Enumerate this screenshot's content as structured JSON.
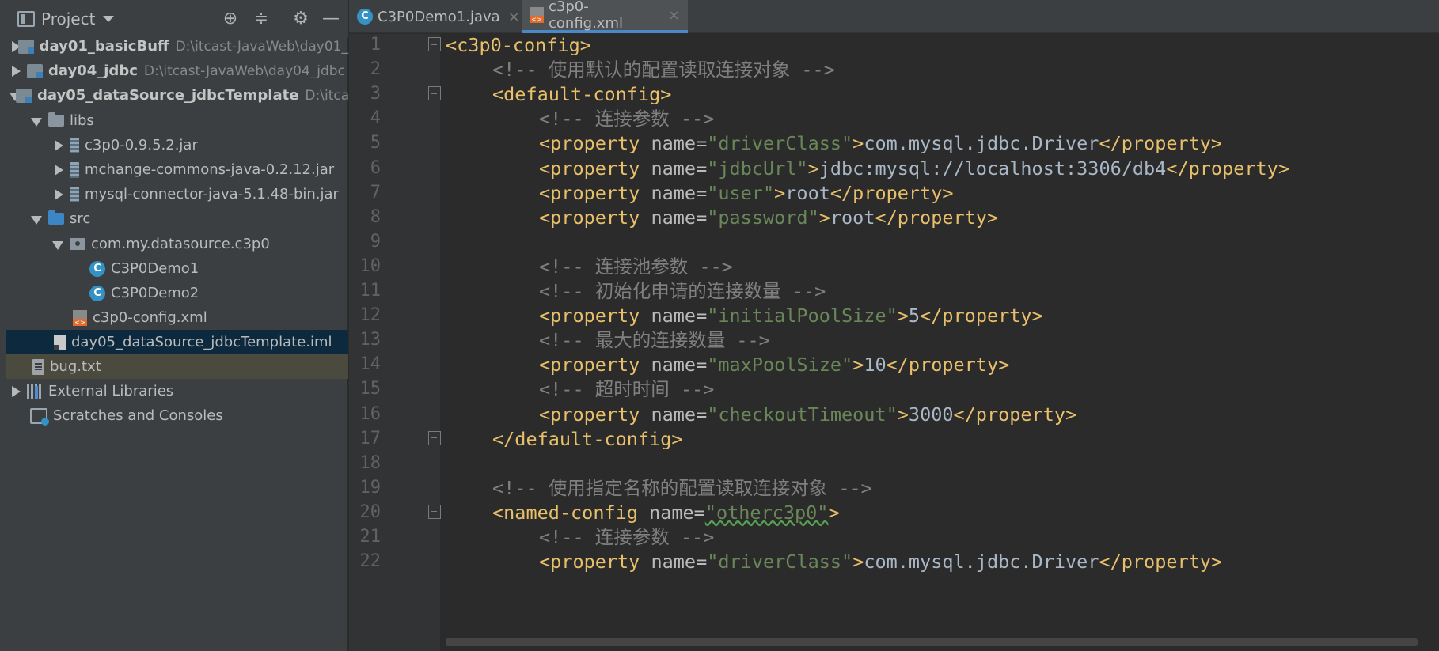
{
  "project_panel": {
    "title": "Project",
    "header_icons": [
      "locate-icon",
      "collapse-all-icon",
      "gear-icon",
      "minimize-icon"
    ],
    "tree": [
      {
        "label": "day01_basicBuff",
        "path": "D:\\itcast-JavaWeb\\day01_",
        "icon": "module-icon",
        "expanded": false
      },
      {
        "label": "day04_jdbc",
        "path": "D:\\itcast-JavaWeb\\day04_jdbc",
        "icon": "module-icon",
        "expanded": false
      },
      {
        "label": "day05_dataSource_jdbcTemplate",
        "path": "D:\\itcast",
        "icon": "module-icon",
        "expanded": true
      },
      {
        "label": "libs",
        "icon": "folder-icon",
        "expanded": true
      },
      {
        "label": "c3p0-0.9.5.2.jar",
        "icon": "jar-icon",
        "expanded": false
      },
      {
        "label": "mchange-commons-java-0.2.12.jar",
        "icon": "jar-icon",
        "expanded": false
      },
      {
        "label": "mysql-connector-java-5.1.48-bin.jar",
        "icon": "jar-icon",
        "expanded": false
      },
      {
        "label": "src",
        "icon": "source-folder-icon",
        "expanded": true
      },
      {
        "label": "com.my.datasource.c3p0",
        "icon": "package-icon",
        "expanded": true
      },
      {
        "label": "C3P0Demo1",
        "icon": "java-class-icon"
      },
      {
        "label": "C3P0Demo2",
        "icon": "java-class-icon"
      },
      {
        "label": "c3p0-config.xml",
        "icon": "xml-file-icon"
      },
      {
        "label": "day05_dataSource_jdbcTemplate.iml",
        "icon": "iml-file-icon",
        "selected": true
      },
      {
        "label": "bug.txt",
        "icon": "text-file-icon"
      },
      {
        "label": "External Libraries",
        "icon": "libraries-icon",
        "expanded": false
      },
      {
        "label": "Scratches and Consoles",
        "icon": "scratches-icon"
      }
    ]
  },
  "tabs": [
    {
      "label": "C3P0Demo1.java",
      "icon": "java-class-icon",
      "active": false
    },
    {
      "label": "c3p0-config.xml",
      "icon": "xml-file-icon",
      "active": true
    }
  ],
  "editor": {
    "line_numbers": [
      "1",
      "2",
      "3",
      "4",
      "5",
      "6",
      "7",
      "8",
      "9",
      "10",
      "11",
      "12",
      "13",
      "14",
      "15",
      "16",
      "17",
      "18",
      "19",
      "20",
      "21",
      "22"
    ],
    "lines": [
      {
        "seg": [
          [
            "t",
            "<c3p0-config>"
          ]
        ]
      },
      {
        "seg": [
          [
            "c",
            "<!-- 使用默认的配置读取连接对象 -->"
          ]
        ]
      },
      {
        "seg": [
          [
            "t",
            "<default-config>"
          ]
        ]
      },
      {
        "seg": [
          [
            "c",
            "<!-- 连接参数 -->"
          ]
        ]
      },
      {
        "seg": [
          [
            "t",
            "<property "
          ],
          [
            "a",
            "name="
          ],
          [
            "v",
            "\"driverClass\""
          ],
          [
            "t",
            ">"
          ],
          [
            "x",
            "com.mysql.jdbc.Driver"
          ],
          [
            "t",
            "</property>"
          ]
        ]
      },
      {
        "seg": [
          [
            "t",
            "<property "
          ],
          [
            "a",
            "name="
          ],
          [
            "v",
            "\"jdbcUrl\""
          ],
          [
            "t",
            ">"
          ],
          [
            "x",
            "jdbc:mysql://localhost:3306/db4"
          ],
          [
            "t",
            "</property>"
          ]
        ]
      },
      {
        "seg": [
          [
            "t",
            "<property "
          ],
          [
            "a",
            "name="
          ],
          [
            "v",
            "\"user\""
          ],
          [
            "t",
            ">"
          ],
          [
            "x",
            "root"
          ],
          [
            "t",
            "</property>"
          ]
        ]
      },
      {
        "seg": [
          [
            "t",
            "<property "
          ],
          [
            "a",
            "name="
          ],
          [
            "v",
            "\"password\""
          ],
          [
            "t",
            ">"
          ],
          [
            "x",
            "root"
          ],
          [
            "t",
            "</property>"
          ]
        ]
      },
      {
        "seg": []
      },
      {
        "seg": [
          [
            "c",
            "<!-- 连接池参数 -->"
          ]
        ]
      },
      {
        "seg": [
          [
            "c",
            "<!-- 初始化申请的连接数量 -->"
          ]
        ]
      },
      {
        "seg": [
          [
            "t",
            "<property "
          ],
          [
            "a",
            "name="
          ],
          [
            "v",
            "\"initialPoolSize\""
          ],
          [
            "t",
            ">"
          ],
          [
            "x",
            "5"
          ],
          [
            "t",
            "</property>"
          ]
        ]
      },
      {
        "seg": [
          [
            "c",
            "<!-- 最大的连接数量 -->"
          ]
        ]
      },
      {
        "seg": [
          [
            "t",
            "<property "
          ],
          [
            "a",
            "name="
          ],
          [
            "v",
            "\"maxPoolSize\""
          ],
          [
            "t",
            ">"
          ],
          [
            "x",
            "10"
          ],
          [
            "t",
            "</property>"
          ]
        ]
      },
      {
        "seg": [
          [
            "c",
            "<!-- 超时时间 -->"
          ]
        ]
      },
      {
        "seg": [
          [
            "t",
            "<property "
          ],
          [
            "a",
            "name="
          ],
          [
            "v",
            "\"checkoutTimeout\""
          ],
          [
            "t",
            ">"
          ],
          [
            "x",
            "3000"
          ],
          [
            "t",
            "</property>"
          ]
        ]
      },
      {
        "seg": [
          [
            "t",
            "</default-config>"
          ]
        ]
      },
      {
        "seg": []
      },
      {
        "seg": [
          [
            "c",
            "<!-- 使用指定名称的配置读取连接对象 -->"
          ]
        ]
      },
      {
        "seg": [
          [
            "t",
            "<named-config "
          ],
          [
            "a",
            "name="
          ],
          [
            "v",
            "\"otherc3p0\""
          ],
          [
            "t",
            ">"
          ]
        ]
      },
      {
        "seg": [
          [
            "c",
            "<!-- 连接参数 -->"
          ]
        ]
      },
      {
        "seg": [
          [
            "t",
            "<property "
          ],
          [
            "a",
            "name="
          ],
          [
            "v",
            "\"driverClass\""
          ],
          [
            "t",
            ">"
          ],
          [
            "x",
            "com.mysql.jdbc.Driver"
          ],
          [
            "t",
            "</property>"
          ]
        ]
      }
    ]
  },
  "colors": {
    "tag": "#e8bf6a",
    "attr": "#bababa",
    "value": "#6a8759",
    "text": "#a9b7c6",
    "comment": "#808080",
    "selection": "#0d293e",
    "accent": "#4a88c7"
  }
}
